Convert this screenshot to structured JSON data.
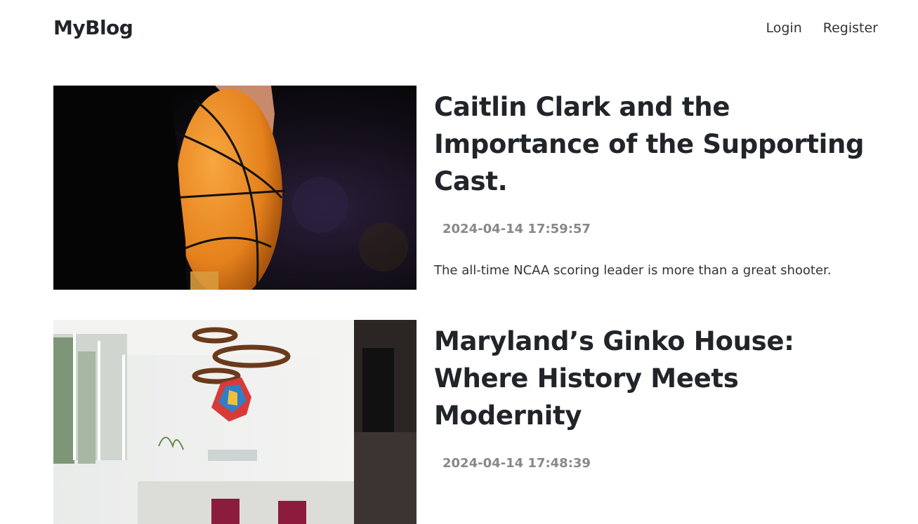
{
  "header": {
    "brand": "MyBlog",
    "nav": {
      "login": "Login",
      "register": "Register"
    }
  },
  "posts": [
    {
      "title": "Caitlin Clark and the Importance of the Supporting Cast.",
      "date": "2024-04-14 17:59:57",
      "excerpt": "The all-time NCAA scoring leader is more than a great shooter.",
      "image": "basketball-photo"
    },
    {
      "title": "Maryland’s Ginko House: Where History Meets Modernity",
      "date": "2024-04-14 17:48:39",
      "excerpt": "",
      "image": "interior-photo"
    }
  ],
  "colors": {
    "text": "#212529",
    "muted": "#888888",
    "background": "#ffffff"
  }
}
